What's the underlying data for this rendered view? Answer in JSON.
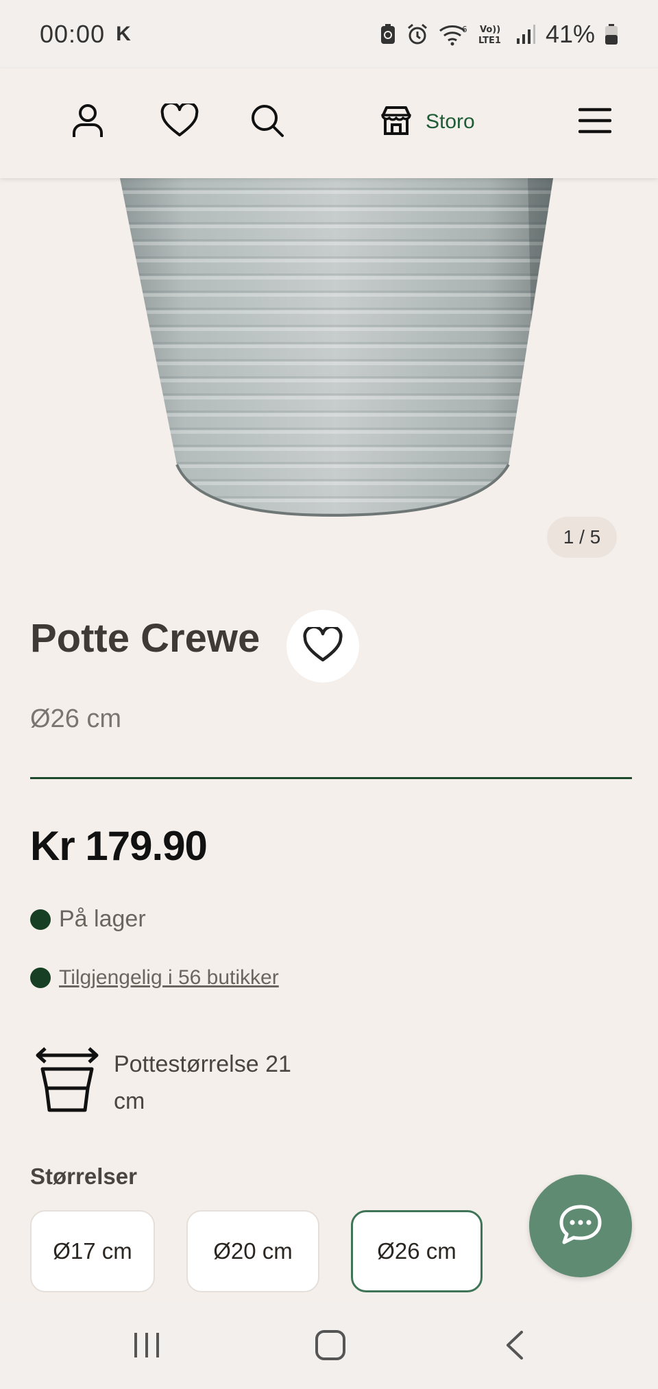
{
  "status_bar": {
    "time": "00:00",
    "carrier_icon_text": "K",
    "battery_percent": "41%",
    "icons": [
      "battery-saver-icon",
      "alarm-icon",
      "wifi-icon",
      "volte-icon",
      "signal-icon",
      "battery-icon"
    ]
  },
  "header": {
    "store_label": "Storo",
    "icons": [
      "user-icon",
      "heart-icon",
      "search-icon",
      "store-icon",
      "menu-icon"
    ]
  },
  "gallery": {
    "counter": "1 / 5",
    "current_index": 1,
    "total": 5
  },
  "product": {
    "title": "Potte Crewe",
    "subtitle": "Ø26 cm",
    "price": "Kr 179.90",
    "stock_status": "På lager",
    "availability_link": "Tilgjengelig i 56 butikker",
    "pot_size_text": "Pottestørrelse 21 cm"
  },
  "sizes": {
    "label": "Størrelser",
    "options": [
      "Ø17 cm",
      "Ø20 cm",
      "Ø26 cm"
    ],
    "selected": "Ø26 cm"
  },
  "colors": {
    "accent_green": "#1f5c36",
    "stock_dot": "#173f24",
    "chat_fab": "#5f8b72",
    "background": "#f4efeb"
  }
}
